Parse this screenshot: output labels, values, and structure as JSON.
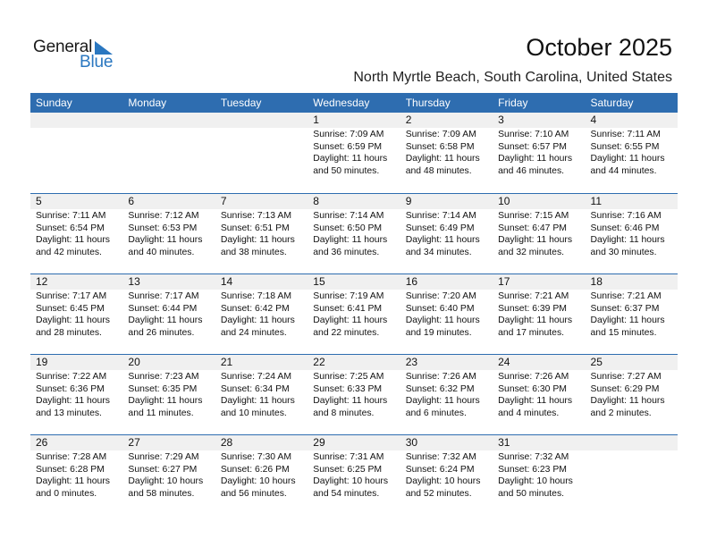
{
  "logo": {
    "word1": "General",
    "word2": "Blue",
    "icon": "triangle-flag-icon",
    "accent": "#2a77c0"
  },
  "title": "October 2025",
  "location": "North Myrtle Beach, South Carolina, United States",
  "colors": {
    "header_bg": "#2e6db0",
    "date_row_bg": "#f0f0f0"
  },
  "weekdays": [
    "Sunday",
    "Monday",
    "Tuesday",
    "Wednesday",
    "Thursday",
    "Friday",
    "Saturday"
  ],
  "weeks": [
    [
      {
        "day": "",
        "sunrise": "",
        "sunset": "",
        "daylight": "",
        "minutes": ""
      },
      {
        "day": "",
        "sunrise": "",
        "sunset": "",
        "daylight": "",
        "minutes": ""
      },
      {
        "day": "",
        "sunrise": "",
        "sunset": "",
        "daylight": "",
        "minutes": ""
      },
      {
        "day": "1",
        "sunrise": "Sunrise: 7:09 AM",
        "sunset": "Sunset: 6:59 PM",
        "daylight": "Daylight: 11 hours",
        "minutes": "and 50 minutes."
      },
      {
        "day": "2",
        "sunrise": "Sunrise: 7:09 AM",
        "sunset": "Sunset: 6:58 PM",
        "daylight": "Daylight: 11 hours",
        "minutes": "and 48 minutes."
      },
      {
        "day": "3",
        "sunrise": "Sunrise: 7:10 AM",
        "sunset": "Sunset: 6:57 PM",
        "daylight": "Daylight: 11 hours",
        "minutes": "and 46 minutes."
      },
      {
        "day": "4",
        "sunrise": "Sunrise: 7:11 AM",
        "sunset": "Sunset: 6:55 PM",
        "daylight": "Daylight: 11 hours",
        "minutes": "and 44 minutes."
      }
    ],
    [
      {
        "day": "5",
        "sunrise": "Sunrise: 7:11 AM",
        "sunset": "Sunset: 6:54 PM",
        "daylight": "Daylight: 11 hours",
        "minutes": "and 42 minutes."
      },
      {
        "day": "6",
        "sunrise": "Sunrise: 7:12 AM",
        "sunset": "Sunset: 6:53 PM",
        "daylight": "Daylight: 11 hours",
        "minutes": "and 40 minutes."
      },
      {
        "day": "7",
        "sunrise": "Sunrise: 7:13 AM",
        "sunset": "Sunset: 6:51 PM",
        "daylight": "Daylight: 11 hours",
        "minutes": "and 38 minutes."
      },
      {
        "day": "8",
        "sunrise": "Sunrise: 7:14 AM",
        "sunset": "Sunset: 6:50 PM",
        "daylight": "Daylight: 11 hours",
        "minutes": "and 36 minutes."
      },
      {
        "day": "9",
        "sunrise": "Sunrise: 7:14 AM",
        "sunset": "Sunset: 6:49 PM",
        "daylight": "Daylight: 11 hours",
        "minutes": "and 34 minutes."
      },
      {
        "day": "10",
        "sunrise": "Sunrise: 7:15 AM",
        "sunset": "Sunset: 6:47 PM",
        "daylight": "Daylight: 11 hours",
        "minutes": "and 32 minutes."
      },
      {
        "day": "11",
        "sunrise": "Sunrise: 7:16 AM",
        "sunset": "Sunset: 6:46 PM",
        "daylight": "Daylight: 11 hours",
        "minutes": "and 30 minutes."
      }
    ],
    [
      {
        "day": "12",
        "sunrise": "Sunrise: 7:17 AM",
        "sunset": "Sunset: 6:45 PM",
        "daylight": "Daylight: 11 hours",
        "minutes": "and 28 minutes."
      },
      {
        "day": "13",
        "sunrise": "Sunrise: 7:17 AM",
        "sunset": "Sunset: 6:44 PM",
        "daylight": "Daylight: 11 hours",
        "minutes": "and 26 minutes."
      },
      {
        "day": "14",
        "sunrise": "Sunrise: 7:18 AM",
        "sunset": "Sunset: 6:42 PM",
        "daylight": "Daylight: 11 hours",
        "minutes": "and 24 minutes."
      },
      {
        "day": "15",
        "sunrise": "Sunrise: 7:19 AM",
        "sunset": "Sunset: 6:41 PM",
        "daylight": "Daylight: 11 hours",
        "minutes": "and 22 minutes."
      },
      {
        "day": "16",
        "sunrise": "Sunrise: 7:20 AM",
        "sunset": "Sunset: 6:40 PM",
        "daylight": "Daylight: 11 hours",
        "minutes": "and 19 minutes."
      },
      {
        "day": "17",
        "sunrise": "Sunrise: 7:21 AM",
        "sunset": "Sunset: 6:39 PM",
        "daylight": "Daylight: 11 hours",
        "minutes": "and 17 minutes."
      },
      {
        "day": "18",
        "sunrise": "Sunrise: 7:21 AM",
        "sunset": "Sunset: 6:37 PM",
        "daylight": "Daylight: 11 hours",
        "minutes": "and 15 minutes."
      }
    ],
    [
      {
        "day": "19",
        "sunrise": "Sunrise: 7:22 AM",
        "sunset": "Sunset: 6:36 PM",
        "daylight": "Daylight: 11 hours",
        "minutes": "and 13 minutes."
      },
      {
        "day": "20",
        "sunrise": "Sunrise: 7:23 AM",
        "sunset": "Sunset: 6:35 PM",
        "daylight": "Daylight: 11 hours",
        "minutes": "and 11 minutes."
      },
      {
        "day": "21",
        "sunrise": "Sunrise: 7:24 AM",
        "sunset": "Sunset: 6:34 PM",
        "daylight": "Daylight: 11 hours",
        "minutes": "and 10 minutes."
      },
      {
        "day": "22",
        "sunrise": "Sunrise: 7:25 AM",
        "sunset": "Sunset: 6:33 PM",
        "daylight": "Daylight: 11 hours",
        "minutes": "and 8 minutes."
      },
      {
        "day": "23",
        "sunrise": "Sunrise: 7:26 AM",
        "sunset": "Sunset: 6:32 PM",
        "daylight": "Daylight: 11 hours",
        "minutes": "and 6 minutes."
      },
      {
        "day": "24",
        "sunrise": "Sunrise: 7:26 AM",
        "sunset": "Sunset: 6:30 PM",
        "daylight": "Daylight: 11 hours",
        "minutes": "and 4 minutes."
      },
      {
        "day": "25",
        "sunrise": "Sunrise: 7:27 AM",
        "sunset": "Sunset: 6:29 PM",
        "daylight": "Daylight: 11 hours",
        "minutes": "and 2 minutes."
      }
    ],
    [
      {
        "day": "26",
        "sunrise": "Sunrise: 7:28 AM",
        "sunset": "Sunset: 6:28 PM",
        "daylight": "Daylight: 11 hours",
        "minutes": "and 0 minutes."
      },
      {
        "day": "27",
        "sunrise": "Sunrise: 7:29 AM",
        "sunset": "Sunset: 6:27 PM",
        "daylight": "Daylight: 10 hours",
        "minutes": "and 58 minutes."
      },
      {
        "day": "28",
        "sunrise": "Sunrise: 7:30 AM",
        "sunset": "Sunset: 6:26 PM",
        "daylight": "Daylight: 10 hours",
        "minutes": "and 56 minutes."
      },
      {
        "day": "29",
        "sunrise": "Sunrise: 7:31 AM",
        "sunset": "Sunset: 6:25 PM",
        "daylight": "Daylight: 10 hours",
        "minutes": "and 54 minutes."
      },
      {
        "day": "30",
        "sunrise": "Sunrise: 7:32 AM",
        "sunset": "Sunset: 6:24 PM",
        "daylight": "Daylight: 10 hours",
        "minutes": "and 52 minutes."
      },
      {
        "day": "31",
        "sunrise": "Sunrise: 7:32 AM",
        "sunset": "Sunset: 6:23 PM",
        "daylight": "Daylight: 10 hours",
        "minutes": "and 50 minutes."
      },
      {
        "day": "",
        "sunrise": "",
        "sunset": "",
        "daylight": "",
        "minutes": ""
      }
    ]
  ]
}
